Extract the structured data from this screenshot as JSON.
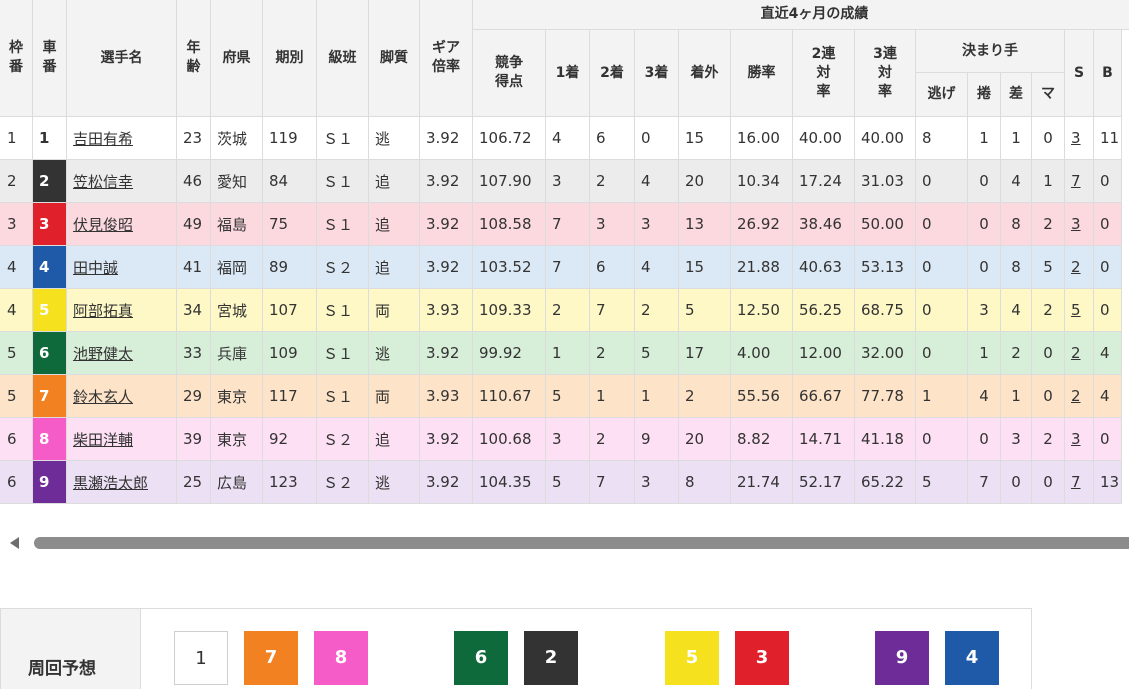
{
  "headers": {
    "waku": "枠番",
    "sha": "車番",
    "name": "選手名",
    "age": "年齢",
    "pref": "府県",
    "term": "期別",
    "class": "級班",
    "style": "脚質",
    "gear": "ギア倍率",
    "recent_group": "直近4ヶ月の成績",
    "score": "競争得点",
    "first": "1着",
    "second": "2着",
    "third": "3着",
    "out": "着外",
    "win_rate": "勝率",
    "rate2": "2連対率",
    "rate3": "3連対率",
    "kimarite": "決まり手",
    "nige": "逃げ",
    "makuri": "捲",
    "sashi": "差",
    "mark": "マ",
    "s": "S",
    "b": "B"
  },
  "colors": {
    "1": "#ffffff",
    "2": "#333333",
    "3": "#e0202a",
    "4": "#1e5aa8",
    "5": "#f5e11e",
    "6": "#0e6a3a",
    "7": "#f28121",
    "8": "#f65cc8",
    "9": "#6e2c98"
  },
  "rows": [
    {
      "waku": "1",
      "sha": "1",
      "name": "吉田有希",
      "age": "23",
      "pref": "茨城",
      "term": "119",
      "class": "Ｓ１",
      "style": "逃",
      "gear": "3.92",
      "score": "106.72",
      "first": "4",
      "second": "6",
      "third": "0",
      "out": "15",
      "win_rate": "16.00",
      "rate2": "40.00",
      "rate3": "40.00",
      "nige": "8",
      "makuri": "1",
      "sashi": "1",
      "mark": "0",
      "s": "3",
      "b": "11",
      "bg": "#ffffff"
    },
    {
      "waku": "2",
      "sha": "2",
      "name": "笠松信幸",
      "age": "46",
      "pref": "愛知",
      "term": "84",
      "class": "Ｓ１",
      "style": "追",
      "gear": "3.92",
      "score": "107.90",
      "first": "3",
      "second": "2",
      "third": "4",
      "out": "20",
      "win_rate": "10.34",
      "rate2": "17.24",
      "rate3": "31.03",
      "nige": "0",
      "makuri": "0",
      "sashi": "4",
      "mark": "1",
      "s": "7",
      "b": "0",
      "bg": "#ececec"
    },
    {
      "waku": "3",
      "sha": "3",
      "name": "伏見俊昭",
      "age": "49",
      "pref": "福島",
      "term": "75",
      "class": "Ｓ１",
      "style": "追",
      "gear": "3.92",
      "score": "108.58",
      "first": "7",
      "second": "3",
      "third": "3",
      "out": "13",
      "win_rate": "26.92",
      "rate2": "38.46",
      "rate3": "50.00",
      "nige": "0",
      "makuri": "0",
      "sashi": "8",
      "mark": "2",
      "s": "3",
      "b": "0",
      "bg": "#fbd9df"
    },
    {
      "waku": "4",
      "sha": "4",
      "name": "田中誠",
      "age": "41",
      "pref": "福岡",
      "term": "89",
      "class": "Ｓ２",
      "style": "追",
      "gear": "3.92",
      "score": "103.52",
      "first": "7",
      "second": "6",
      "third": "4",
      "out": "15",
      "win_rate": "21.88",
      "rate2": "40.63",
      "rate3": "53.13",
      "nige": "0",
      "makuri": "0",
      "sashi": "8",
      "mark": "5",
      "s": "2",
      "b": "0",
      "bg": "#dbe8f5"
    },
    {
      "waku": "4",
      "sha": "5",
      "name": "阿部拓真",
      "age": "34",
      "pref": "宮城",
      "term": "107",
      "class": "Ｓ１",
      "style": "両",
      "gear": "3.93",
      "score": "109.33",
      "first": "2",
      "second": "7",
      "third": "2",
      "out": "5",
      "win_rate": "12.50",
      "rate2": "56.25",
      "rate3": "68.75",
      "nige": "0",
      "makuri": "3",
      "sashi": "4",
      "mark": "2",
      "s": "5",
      "b": "0",
      "bg": "#fdf8c6"
    },
    {
      "waku": "5",
      "sha": "6",
      "name": "池野健太",
      "age": "33",
      "pref": "兵庫",
      "term": "109",
      "class": "Ｓ１",
      "style": "逃",
      "gear": "3.92",
      "score": "99.92",
      "first": "1",
      "second": "2",
      "third": "5",
      "out": "17",
      "win_rate": "4.00",
      "rate2": "12.00",
      "rate3": "32.00",
      "nige": "0",
      "makuri": "1",
      "sashi": "2",
      "mark": "0",
      "s": "2",
      "b": "4",
      "bg": "#d7eed9"
    },
    {
      "waku": "5",
      "sha": "7",
      "name": "鈴木玄人",
      "age": "29",
      "pref": "東京",
      "term": "117",
      "class": "Ｓ１",
      "style": "両",
      "gear": "3.93",
      "score": "110.67",
      "first": "5",
      "second": "1",
      "third": "1",
      "out": "2",
      "win_rate": "55.56",
      "rate2": "66.67",
      "rate3": "77.78",
      "nige": "1",
      "makuri": "4",
      "sashi": "1",
      "mark": "0",
      "s": "2",
      "b": "4",
      "bg": "#fde3c8"
    },
    {
      "waku": "6",
      "sha": "8",
      "name": "柴田洋輔",
      "age": "39",
      "pref": "東京",
      "term": "92",
      "class": "Ｓ２",
      "style": "追",
      "gear": "3.92",
      "score": "100.68",
      "first": "3",
      "second": "2",
      "third": "9",
      "out": "20",
      "win_rate": "8.82",
      "rate2": "14.71",
      "rate3": "41.18",
      "nige": "0",
      "makuri": "0",
      "sashi": "3",
      "mark": "2",
      "s": "3",
      "b": "0",
      "bg": "#fde0f3"
    },
    {
      "waku": "6",
      "sha": "9",
      "name": "黒瀬浩太郎",
      "age": "25",
      "pref": "広島",
      "term": "123",
      "class": "Ｓ２",
      "style": "逃",
      "gear": "3.92",
      "score": "104.35",
      "first": "5",
      "second": "7",
      "third": "3",
      "out": "8",
      "win_rate": "21.74",
      "rate2": "52.17",
      "rate3": "65.22",
      "nige": "5",
      "makuri": "7",
      "sashi": "0",
      "mark": "0",
      "s": "7",
      "b": "13",
      "bg": "#ece0f5"
    }
  ],
  "prediction": {
    "label": "周回予想",
    "order": [
      {
        "num": "1",
        "bg": "#ffffff"
      },
      {
        "num": "7",
        "bg": "#f28121"
      },
      {
        "num": "8",
        "bg": "#f65cc8"
      },
      {
        "num": "6",
        "bg": "#0e6a3a"
      },
      {
        "num": "2",
        "bg": "#333333"
      },
      {
        "num": "5",
        "bg": "#f5e11e"
      },
      {
        "num": "3",
        "bg": "#e0202a"
      },
      {
        "num": "9",
        "bg": "#6e2c98"
      },
      {
        "num": "4",
        "bg": "#1e5aa8"
      }
    ]
  }
}
